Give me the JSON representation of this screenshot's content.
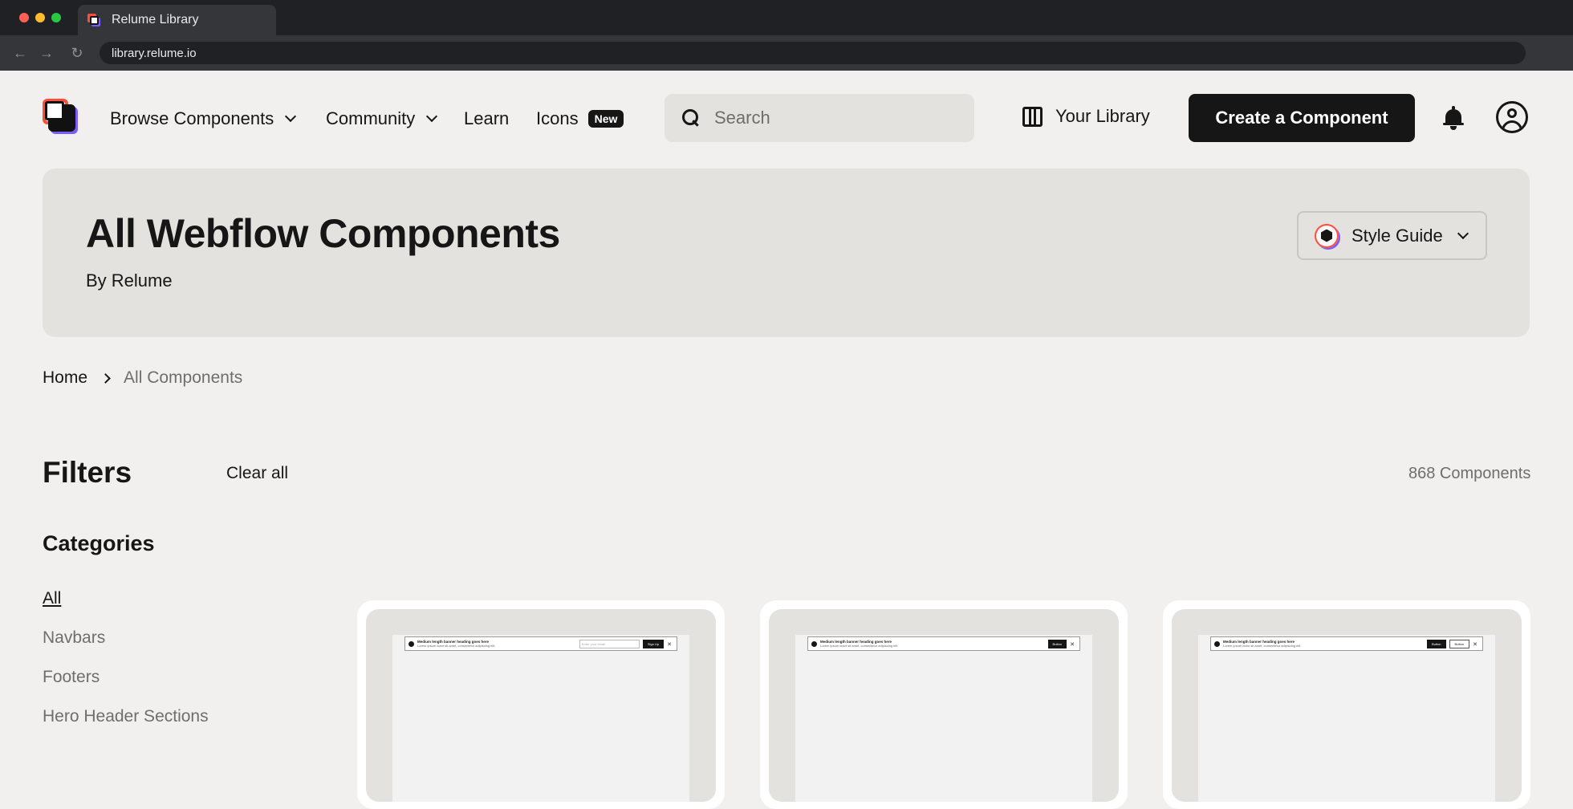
{
  "browser": {
    "tab_title": "Relume Library",
    "url": "library.relume.io",
    "back_icon": "arrow-left-icon",
    "forward_icon": "arrow-right-icon",
    "reload_icon": "reload-icon"
  },
  "nav": {
    "browse": "Browse Components",
    "community": "Community",
    "learn": "Learn",
    "icons": "Icons",
    "icons_badge": "New",
    "search_placeholder": "Search",
    "your_library": "Your Library",
    "create": "Create a Component"
  },
  "hero": {
    "title": "All Webflow Components",
    "subtitle": "By Relume",
    "style_guide": "Style Guide"
  },
  "breadcrumb": {
    "home": "Home",
    "current": "All Components"
  },
  "filters": {
    "title": "Filters",
    "clear_all": "Clear all",
    "count": "868 Components",
    "categories_title": "Categories",
    "categories": [
      "All",
      "Navbars",
      "Footers",
      "Hero Header Sections"
    ]
  },
  "cards": [
    {
      "heading": "Medium length banner heading goes here",
      "body": "Lorem ipsum dolor sit amet, consectetur adipiscing elit.",
      "input_placeholder": "Enter your email",
      "button1": "Sign Up",
      "button2": ""
    },
    {
      "heading": "Medium length banner heading goes here",
      "body": "Lorem ipsum dolor sit amet, consectetur adipiscing elit.",
      "input_placeholder": "",
      "button1": "Button",
      "button2": ""
    },
    {
      "heading": "Medium length banner heading goes here",
      "body": "Lorem ipsum dolor sit amet, consectetur adipiscing elit.",
      "input_placeholder": "",
      "button1": "Button",
      "button2": "Button"
    }
  ],
  "colors": {
    "accent_red": "#ff4d3a",
    "accent_purple": "#7c5cff",
    "ink": "#161616",
    "page_bg": "#f1f0ee"
  }
}
